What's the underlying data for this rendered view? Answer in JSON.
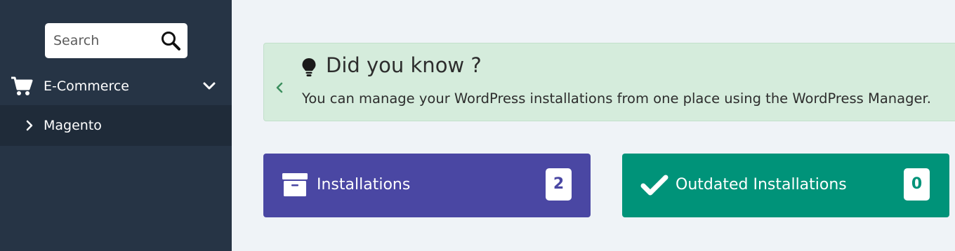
{
  "sidebar": {
    "search": {
      "placeholder": "Search",
      "value": ""
    },
    "nav": [
      {
        "label": "E-Commerce",
        "icon": "cart-icon",
        "expanded": true
      }
    ],
    "subnav": [
      {
        "label": "Magento",
        "icon": "chevron-right-icon"
      }
    ],
    "colors": {
      "background": "#263445",
      "active_background": "#1f2b39"
    }
  },
  "info_panel": {
    "title": "Did you know ?",
    "text": "You can manage your WordPress installations from one place using the WordPress Manager.",
    "icon": "lightbulb-icon",
    "background": "#d5ecdc"
  },
  "cards": [
    {
      "label": "Installations",
      "count": "2",
      "icon": "archive-box-icon",
      "color": "#4a47a3"
    },
    {
      "label": "Outdated Installations",
      "count": "0",
      "icon": "checkmark-icon",
      "color": "#009379"
    }
  ]
}
